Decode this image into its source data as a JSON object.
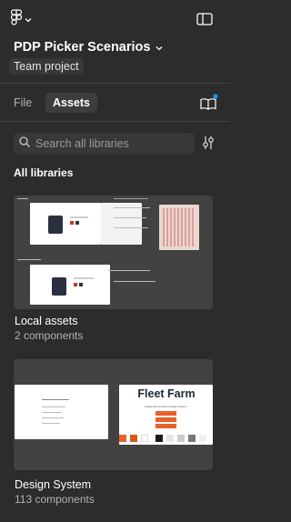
{
  "header": {
    "file_name": "PDP Picker Scenarios",
    "project_label": "Team project"
  },
  "tabs": [
    {
      "label": "File"
    },
    {
      "label": "Assets"
    }
  ],
  "search": {
    "placeholder": "Search all libraries"
  },
  "section": {
    "title": "All libraries"
  },
  "libraries": [
    {
      "name": "Local assets",
      "count": "2 components"
    },
    {
      "name": "Design System",
      "count": "113 components"
    }
  ],
  "thumbnails": {
    "design_system_brand": "Fleet Farm",
    "design_system_tagline": "Digital Ecommerce Design System"
  },
  "colors": {
    "panel_bg": "#2c2c2c",
    "card_bg": "#424242",
    "accent": "#0d99ff",
    "brand_orange": "#e8612c"
  }
}
